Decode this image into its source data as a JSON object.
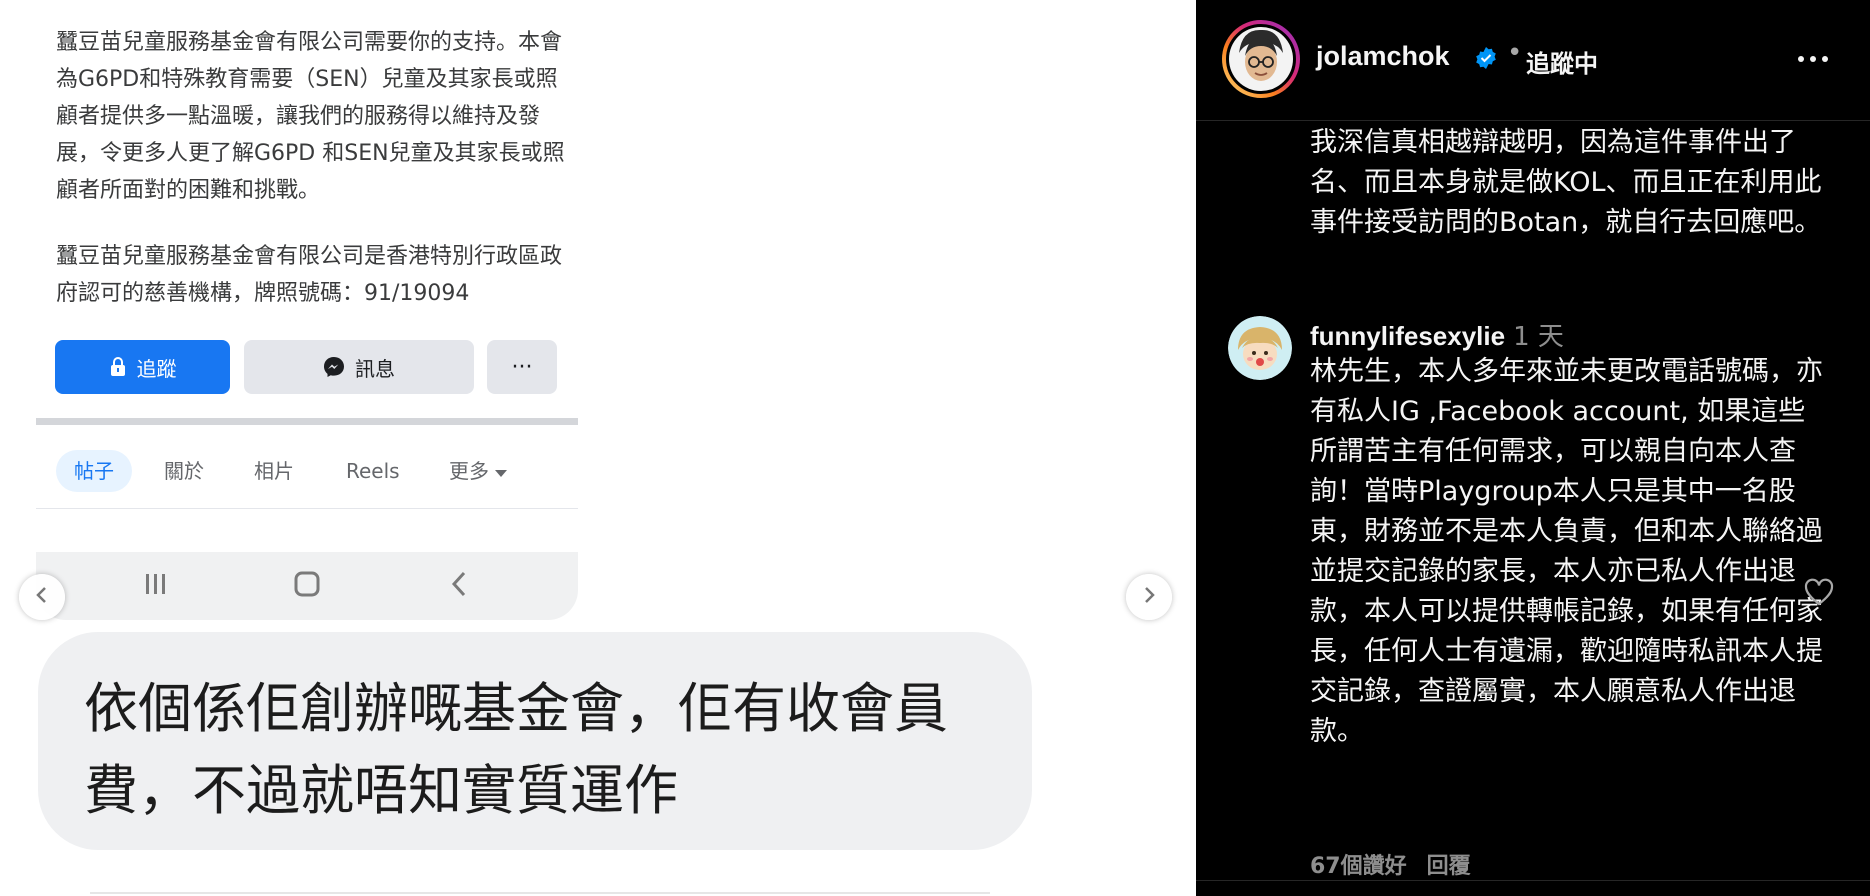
{
  "facebook_page": {
    "para1": "蠶豆苗兒童服務基金會有限公司需要你的支持。本會為G6PD和特殊教育需要（SEN）兒童及其家長或照顧者提供多一點溫暖，讓我們的服務得以維持及發展，令更多人更了解G6PD 和SEN兒童及其家長或照顧者所面對的困難和挑戰。",
    "para2": "蠶豆苗兒童服務基金會有限公司是香港特別行政區政府認可的慈善機構，牌照號碼：91/19094",
    "buttons": {
      "follow": "追蹤",
      "message": "訊息",
      "more": "···"
    },
    "tabs": {
      "posts": "帖子",
      "about": "關於",
      "photos": "相片",
      "reels": "Reels",
      "more": "更多"
    }
  },
  "chat_message": "依個係佢創辦嘅基金會，佢有收會員費，不過就唔知實質運作",
  "instagram": {
    "header": {
      "username": "jolamchok",
      "separator": "•",
      "follow_status": "追蹤中"
    },
    "caption": "我深信真相越辯越明，因為這件事件出了名、而且本身就是做KOL、而且正在利用此事件接受訪問的Botan，就自行去回應吧。",
    "comment": {
      "username": "funnylifesexylie",
      "time": "1 天",
      "text": "林先生，本人多年來並未更改電話號碼，亦有私人IG ,Facebook account, 如果這些所謂苦主有任何需求，可以親自向本人查詢！當時Playgroup本人只是其中一名股東，財務並不是本人負責，但和本人聯絡過並提交記錄的家長，本人亦已私人作出退款，本人可以提供轉帳記錄，如果有任何家長，任何人士有遺漏，歡迎隨時私訊本人提交記錄，查證屬實，本人願意私人作出退款。",
      "likes": "67個讚好",
      "reply": "回覆"
    }
  },
  "icons": {
    "prev": "chevron-left-icon",
    "next": "chevron-right-icon",
    "verified": "verified-badge-icon",
    "options": "more-horizontal-icon",
    "like": "heart-outline-icon"
  },
  "colors": {
    "fb_blue": "#1877f2",
    "ig_bg": "#000000",
    "ig_verified": "#0095f6"
  }
}
